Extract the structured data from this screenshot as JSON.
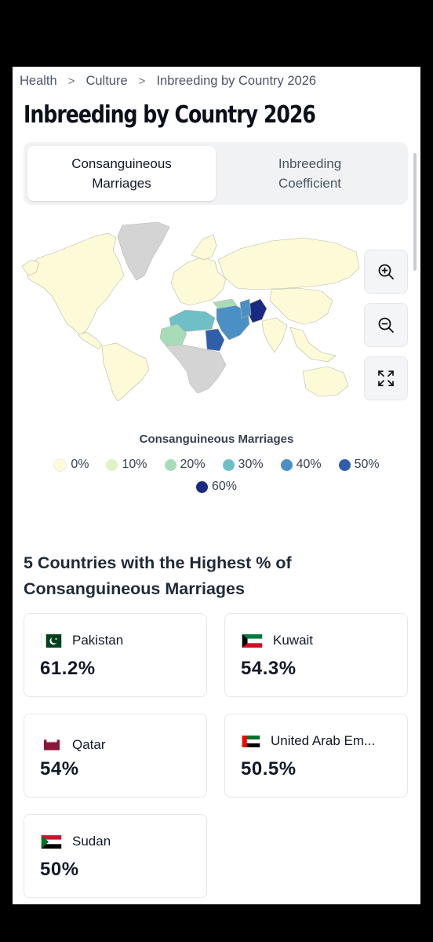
{
  "breadcrumb": {
    "items": [
      "Health",
      "Culture",
      "Inbreeding by Country 2026"
    ],
    "separator": ">"
  },
  "title": "Inbreeding by Country 2026",
  "tabs": [
    {
      "label": "Consanguineous\nMarriages",
      "active": true
    },
    {
      "label": "Inbreeding\nCoefficient",
      "active": false
    }
  ],
  "map_controls": {
    "zoom_in": "zoom-in-icon",
    "zoom_out": "zoom-out-icon",
    "fullscreen": "expand-icon"
  },
  "legend": {
    "title": "Consanguineous Marriages",
    "items": [
      {
        "label": "0%",
        "color": "#fdfbd7"
      },
      {
        "label": "10%",
        "color": "#dff2c4"
      },
      {
        "label": "20%",
        "color": "#a8dcb8"
      },
      {
        "label": "30%",
        "color": "#6fbfc6"
      },
      {
        "label": "40%",
        "color": "#4a90c4"
      },
      {
        "label": "50%",
        "color": "#2f5fab"
      },
      {
        "label": "60%",
        "color": "#1a2a80"
      }
    ]
  },
  "colors": {
    "no_data": "#d4d4d4",
    "background": "#ffffff"
  },
  "top_section": {
    "title": "5 Countries with the Highest % of Consanguineous Marriages",
    "countries": [
      {
        "name": "Pakistan",
        "value": "61.2%",
        "flag": "pakistan-flag"
      },
      {
        "name": "Kuwait",
        "value": "54.3%",
        "flag": "kuwait-flag"
      },
      {
        "name": "Qatar",
        "value": "54%",
        "flag": "qatar-flag"
      },
      {
        "name": "United Arab Em...",
        "value": "50.5%",
        "flag": "uae-flag"
      },
      {
        "name": "Sudan",
        "value": "50%",
        "flag": "sudan-flag"
      }
    ]
  }
}
